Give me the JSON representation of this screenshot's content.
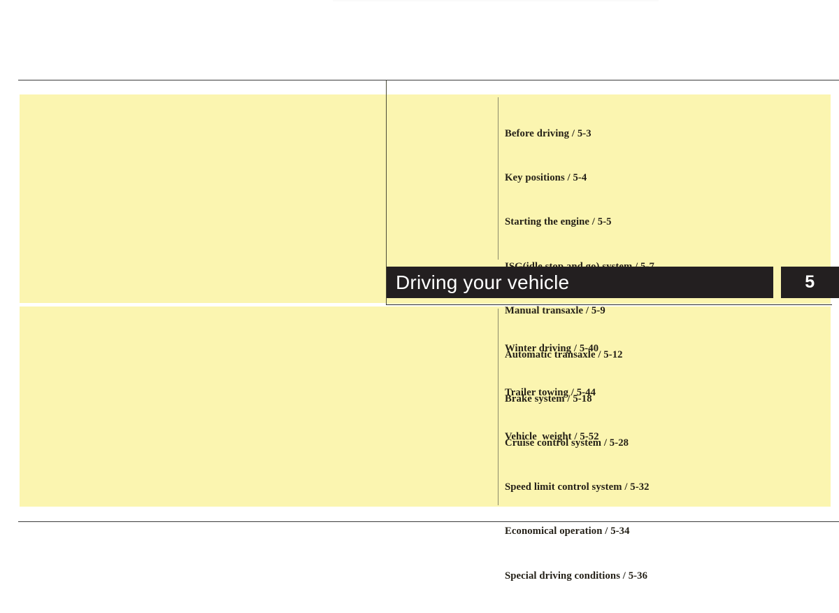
{
  "page": {
    "background_color": "#ffffff",
    "panel_color": "#fbf5b0",
    "bar_color": "#231f20",
    "text_color": "#231f16"
  },
  "chapter": {
    "title": "Driving your vehicle",
    "number": "5"
  },
  "toc_upper": [
    "Before driving / 5-3",
    "Key positions / 5-4",
    "Starting the engine / 5-5",
    "ISG(idle stop and go) system / 5-7",
    "Manual transaxle / 5-9",
    "Automatic transaxle / 5-12",
    "Brake system / 5-18",
    "Cruise control system / 5-28",
    "Speed limit control system / 5-32",
    "Economical operation / 5-34",
    "Special driving conditions / 5-36"
  ],
  "toc_lower": [
    "Winter driving / 5-40",
    "Trailer towing / 5-44",
    "Vehicle  weight / 5-52"
  ]
}
